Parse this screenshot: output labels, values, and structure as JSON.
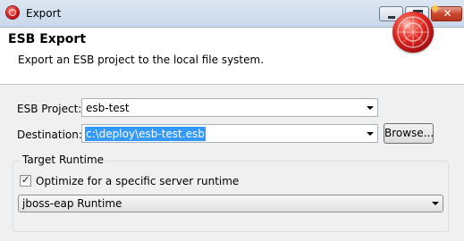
{
  "window": {
    "title": "Export",
    "minimize_icon": "minimize-icon",
    "maximize_icon": "maximize-icon",
    "close_icon": "close-icon",
    "close_glyph": "✕"
  },
  "banner": {
    "title": "ESB Export",
    "description": "Export an ESB project to the local file system.",
    "icon": "esb-export-wizard-icon"
  },
  "form": {
    "project_label": "ESB Project:",
    "project_value": "esb-test",
    "destination_label": "Destination:",
    "destination_value": "c:\\deploy\\esb-test.esb",
    "browse_label": "Browse..."
  },
  "target_runtime": {
    "group_title": "Target Runtime",
    "optimize_label": "Optimize for a specific server runtime",
    "optimize_checked": true,
    "runtime_value": "jboss-eap Runtime"
  }
}
